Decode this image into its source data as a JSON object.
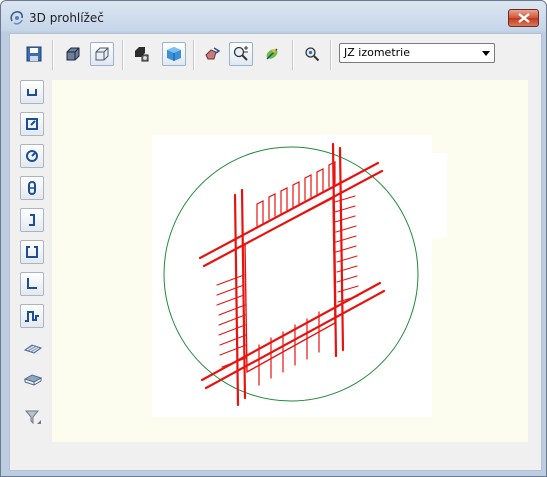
{
  "window": {
    "title": "3D prohlížeč",
    "app_icon": "viewer-3d-icon"
  },
  "toolbar": {
    "buttons": [
      {
        "name": "save-icon"
      },
      {
        "name": "wireframe-box-icon"
      },
      {
        "name": "outline-box-icon"
      },
      {
        "name": "render-settings-icon"
      },
      {
        "name": "solid-box-icon"
      },
      {
        "name": "rotate-icon"
      },
      {
        "name": "zoom-in-out-icon"
      },
      {
        "name": "pan-icon"
      },
      {
        "name": "zoom-extents-icon"
      }
    ],
    "view_select": {
      "value": "JZ izometrie"
    }
  },
  "side_tools": [
    {
      "name": "shape-u-icon"
    },
    {
      "name": "shape-square-hook-icon"
    },
    {
      "name": "shape-circle-hook-icon"
    },
    {
      "name": "shape-loop-icon"
    },
    {
      "name": "shape-j-icon"
    },
    {
      "name": "shape-open-rect-icon"
    },
    {
      "name": "shape-l-icon"
    },
    {
      "name": "shape-wave-icon"
    },
    {
      "name": "mesh-layer-icon"
    },
    {
      "name": "mesh-stack-icon"
    },
    {
      "name": "filter-icon"
    }
  ],
  "colors": {
    "rebar": "#e8130f",
    "bounding_circle": "#1f8a3a",
    "viewport_bg": "#fdfdef"
  }
}
